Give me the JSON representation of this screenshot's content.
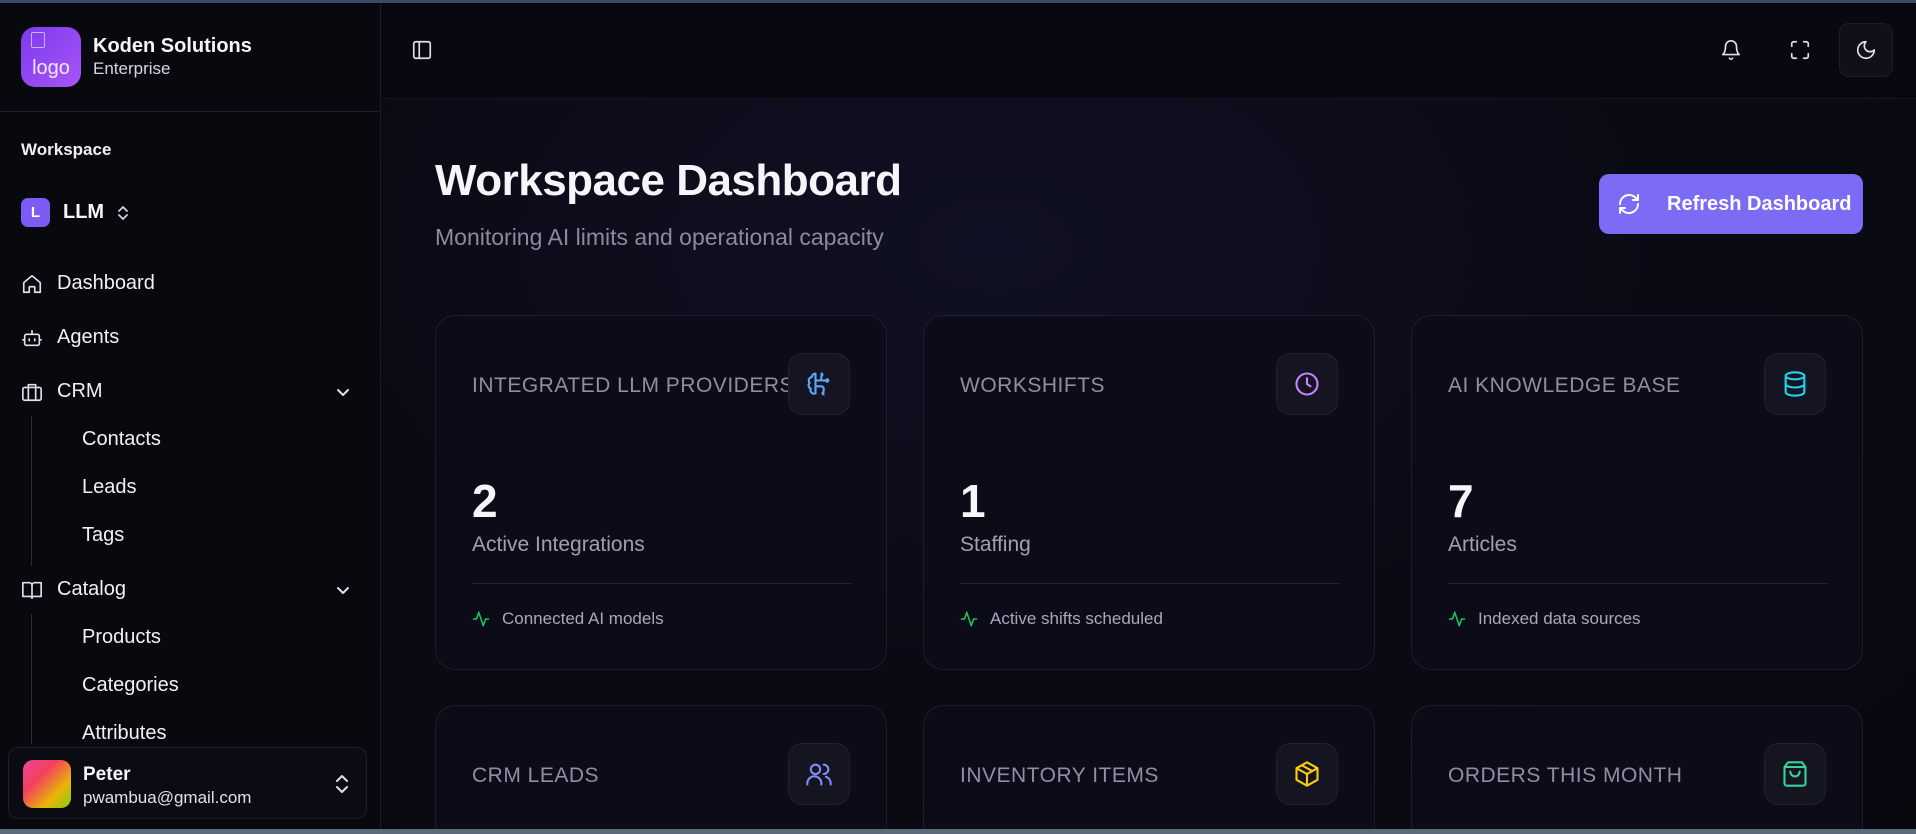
{
  "brand": {
    "name": "Koden Solutions",
    "plan": "Enterprise",
    "logo_alt": "logo"
  },
  "sidebar": {
    "section_label": "Workspace",
    "workspace": {
      "badge": "L",
      "name": "LLM"
    },
    "items": [
      {
        "label": "Dashboard",
        "icon": "home-icon"
      },
      {
        "label": "Agents",
        "icon": "bot-icon"
      },
      {
        "label": "CRM",
        "icon": "building-icon",
        "expanded": true,
        "children": [
          "Contacts",
          "Leads",
          "Tags"
        ]
      },
      {
        "label": "Catalog",
        "icon": "book-icon",
        "expanded": true,
        "children": [
          "Products",
          "Categories",
          "Attributes"
        ]
      }
    ]
  },
  "user": {
    "name": "Peter",
    "email": "pwambua@gmail.com"
  },
  "header": {
    "icons": [
      "sidebar-toggle-icon",
      "bell-icon",
      "fullscreen-icon",
      "moon-icon"
    ]
  },
  "main": {
    "title": "Workspace Dashboard",
    "subtitle": "Monitoring AI limits and operational capacity",
    "refresh_label": "Refresh Dashboard",
    "cards": [
      {
        "title": "INTEGRATED LLM PROVIDERS",
        "icon": "brain-icon",
        "color": "#60a5fa",
        "value": "2",
        "label": "Active Integrations",
        "footer": "Connected AI models"
      },
      {
        "title": "WORKSHIFTS",
        "icon": "clock-icon",
        "color": "#c084fc",
        "value": "1",
        "label": "Staffing",
        "footer": "Active shifts scheduled"
      },
      {
        "title": "AI KNOWLEDGE BASE",
        "icon": "database-icon",
        "color": "#22d3ee",
        "value": "7",
        "label": "Articles",
        "footer": "Indexed data sources"
      },
      {
        "title": "CRM LEADS",
        "icon": "users-icon",
        "color": "#818cf8"
      },
      {
        "title": "INVENTORY ITEMS",
        "icon": "package-icon",
        "color": "#facc15"
      },
      {
        "title": "ORDERS THIS MONTH",
        "icon": "shopping-bag-icon",
        "color": "#34d399"
      }
    ],
    "footer_icon_color": "#22c55e",
    "accent": "#7c6cf5"
  }
}
